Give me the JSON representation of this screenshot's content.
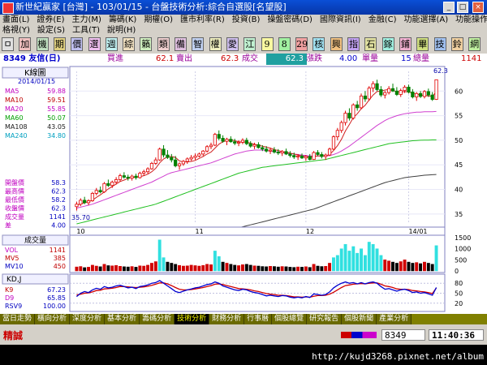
{
  "window": {
    "app_title": "新世紀贏家 [台灣] - 103/01/15 - 台盤技術分析:綜合自選股[名望股]",
    "minimize_label": "_",
    "maximize_label": "□",
    "close_label": "×"
  },
  "menu_row1": [
    "畫面(L)",
    "證券(E)",
    "主力(M)",
    "籌碼(K)",
    "期權(O)",
    "匯市利率(R)",
    "投資(B)",
    "操盤密碼(D)",
    "國際資訊(I)",
    "金融(C)",
    "功能選擇(A)",
    "功能操作(F)"
  ],
  "menu_row2": [
    "格視(Y)",
    "設定(S)",
    "工具(T)",
    "說明(H)"
  ],
  "toolbar": [
    "ㅁ",
    "加",
    "機",
    "期",
    "價",
    "選",
    "週",
    "綜",
    "籟",
    "類",
    "備",
    "智",
    "權",
    "愛",
    "江",
    "9",
    "8",
    "29",
    "核",
    "興",
    "指",
    "石",
    "鎵",
    "鋪",
    "畢",
    "技",
    "鈴",
    "網"
  ],
  "infobar": {
    "stock": "8349 友信(日)",
    "buy_label": "買進",
    "buy_value": "62.1",
    "sell_label": "賣出",
    "sell_value": "62.3",
    "deal_label": "成交",
    "deal_value": "62.3",
    "change_label": "漲跌",
    "change_value": "4.00",
    "unit_label": "單量",
    "unit_value": "15",
    "total_label": "總量",
    "total_value": "1141"
  },
  "legend": {
    "title": "K線圖",
    "date": "2014/01/15",
    "ma": [
      {
        "name": "MA5",
        "value": "59.88",
        "color": "#c000c0"
      },
      {
        "name": "MA10",
        "value": "59.51",
        "color": "#c00000"
      },
      {
        "name": "MA20",
        "value": "55.85",
        "color": "#c000c0"
      },
      {
        "name": "MA60",
        "value": "50.07",
        "color": "#00a000"
      },
      {
        "name": "MA108",
        "value": "43.05",
        "color": "#202020"
      },
      {
        "name": "MA240",
        "value": "34.80",
        "color": "#00a0c0"
      }
    ],
    "quote": [
      {
        "name": "開盤價",
        "value": "58.3"
      },
      {
        "name": "最高價",
        "value": "62.3"
      },
      {
        "name": "最低價",
        "value": "58.2"
      },
      {
        "name": "收盤價",
        "value": "62.3"
      },
      {
        "name": "成交量",
        "value": "1141"
      },
      {
        "name": "差",
        "value": "4.00"
      }
    ],
    "low_marker": "35.70",
    "high_marker": "62.3"
  },
  "volume_panel": {
    "title": "成交量",
    "rows": [
      {
        "name": "VOL",
        "value": "1141"
      },
      {
        "name": "MV5",
        "value": "385"
      },
      {
        "name": "MV10",
        "value": "450"
      }
    ]
  },
  "kd_panel": {
    "title": "KD,J",
    "rows": [
      {
        "name": "K9",
        "value": "67.23"
      },
      {
        "name": "D9",
        "value": "65.85"
      },
      {
        "name": "RSV9",
        "value": "100.00"
      }
    ]
  },
  "chart_data": {
    "type": "candlestick",
    "price_ticks": [
      "60",
      "55",
      "50",
      "45",
      "40",
      "35"
    ],
    "price_ylim": [
      33,
      64
    ],
    "month_labels": [
      {
        "label": "10",
        "x": 0
      },
      {
        "label": "11",
        "x": 30
      },
      {
        "label": "12",
        "x": 58
      },
      {
        "label": "14/01",
        "x": 84
      }
    ],
    "volume_ticks": [
      "1500",
      "1000",
      "500",
      "0"
    ],
    "volume_ylim": [
      0,
      1500
    ],
    "kd_ticks": [
      "80",
      "50",
      "20"
    ],
    "kd_ylim": [
      0,
      100
    ],
    "candles": [
      [
        36.5,
        37.5,
        35.7,
        37.0
      ],
      [
        37.0,
        38.2,
        36.6,
        37.8
      ],
      [
        37.8,
        38.5,
        37.0,
        37.3
      ],
      [
        37.3,
        38.0,
        36.8,
        37.7
      ],
      [
        37.7,
        39.5,
        37.5,
        39.2
      ],
      [
        39.2,
        40.3,
        38.8,
        39.8
      ],
      [
        39.8,
        40.6,
        39.2,
        39.5
      ],
      [
        39.5,
        41.5,
        39.3,
        41.2
      ],
      [
        41.2,
        42.0,
        40.5,
        40.8
      ],
      [
        40.8,
        41.8,
        40.3,
        41.5
      ],
      [
        41.5,
        42.5,
        41.0,
        42.0
      ],
      [
        42.0,
        43.2,
        41.6,
        42.8
      ],
      [
        42.8,
        43.5,
        42.2,
        42.5
      ],
      [
        42.5,
        43.0,
        41.8,
        42.3
      ],
      [
        42.3,
        43.0,
        41.8,
        42.7
      ],
      [
        42.7,
        43.2,
        42.0,
        42.4
      ],
      [
        42.4,
        43.6,
        42.2,
        43.3
      ],
      [
        43.3,
        44.0,
        42.8,
        43.6
      ],
      [
        43.6,
        44.5,
        43.2,
        44.2
      ],
      [
        44.2,
        45.6,
        44.0,
        45.3
      ],
      [
        45.3,
        46.5,
        45.0,
        46.0
      ],
      [
        46.0,
        48.5,
        45.8,
        48.2
      ],
      [
        48.2,
        49.0,
        46.5,
        47.0
      ],
      [
        47.0,
        48.0,
        46.2,
        46.5
      ],
      [
        46.5,
        47.2,
        45.5,
        46.0
      ],
      [
        46.0,
        46.8,
        44.5,
        44.8
      ],
      [
        44.8,
        45.5,
        44.0,
        45.2
      ],
      [
        45.2,
        46.0,
        44.8,
        45.7
      ],
      [
        45.7,
        46.5,
        45.2,
        46.2
      ],
      [
        46.2,
        47.0,
        45.8,
        46.5
      ],
      [
        46.5,
        47.3,
        46.0,
        46.8
      ],
      [
        46.8,
        47.5,
        46.5,
        47.2
      ],
      [
        47.2,
        48.0,
        46.8,
        47.8
      ],
      [
        47.8,
        49.0,
        47.5,
        48.7
      ],
      [
        48.7,
        49.5,
        48.2,
        49.0
      ],
      [
        49.0,
        51.5,
        48.8,
        51.2
      ],
      [
        51.2,
        52.0,
        50.0,
        50.4
      ],
      [
        50.4,
        51.0,
        49.5,
        49.8
      ],
      [
        49.8,
        50.5,
        49.0,
        50.2
      ],
      [
        50.2,
        50.8,
        49.5,
        49.7
      ],
      [
        49.7,
        50.3,
        49.0,
        49.4
      ],
      [
        49.4,
        50.0,
        48.8,
        49.6
      ],
      [
        49.6,
        50.4,
        49.2,
        50.0
      ],
      [
        50.0,
        50.5,
        49.0,
        49.3
      ],
      [
        49.3,
        49.8,
        48.5,
        48.8
      ],
      [
        48.8,
        49.5,
        48.2,
        49.1
      ],
      [
        49.1,
        49.6,
        48.3,
        48.5
      ],
      [
        48.5,
        49.0,
        47.8,
        48.2
      ],
      [
        48.2,
        48.8,
        47.5,
        47.8
      ],
      [
        47.8,
        48.5,
        47.2,
        48.0
      ],
      [
        48.0,
        48.6,
        47.3,
        47.6
      ],
      [
        47.6,
        48.2,
        47.0,
        47.4
      ],
      [
        47.4,
        48.0,
        46.8,
        47.7
      ],
      [
        47.7,
        48.3,
        47.0,
        47.2
      ],
      [
        47.2,
        47.8,
        46.5,
        46.9
      ],
      [
        46.9,
        47.5,
        46.2,
        46.6
      ],
      [
        46.6,
        47.2,
        46.0,
        46.8
      ],
      [
        46.8,
        47.3,
        46.2,
        46.4
      ],
      [
        46.4,
        47.0,
        45.8,
        46.7
      ],
      [
        46.7,
        47.2,
        45.9,
        46.1
      ],
      [
        46.1,
        47.8,
        46.0,
        47.5
      ],
      [
        47.5,
        48.0,
        46.8,
        47.1
      ],
      [
        47.1,
        47.6,
        46.3,
        46.7
      ],
      [
        46.7,
        47.3,
        46.0,
        47.0
      ],
      [
        47.0,
        48.5,
        46.8,
        48.2
      ],
      [
        48.2,
        51.0,
        48.0,
        50.7
      ],
      [
        50.7,
        52.5,
        50.0,
        52.0
      ],
      [
        52.0,
        54.0,
        51.5,
        53.6
      ],
      [
        53.6,
        56.0,
        53.0,
        55.5
      ],
      [
        55.5,
        56.5,
        54.0,
        54.5
      ],
      [
        54.5,
        57.5,
        54.2,
        57.2
      ],
      [
        57.2,
        58.0,
        56.0,
        56.6
      ],
      [
        56.6,
        59.5,
        56.3,
        59.0
      ],
      [
        59.0,
        60.0,
        57.8,
        58.4
      ],
      [
        58.4,
        61.0,
        58.0,
        60.6
      ],
      [
        60.6,
        62.0,
        59.8,
        61.5
      ],
      [
        61.5,
        62.3,
        60.0,
        60.3
      ],
      [
        60.3,
        61.0,
        58.8,
        59.2
      ],
      [
        59.2,
        60.0,
        58.5,
        59.7
      ],
      [
        59.7,
        61.0,
        59.3,
        60.5
      ],
      [
        60.5,
        61.5,
        59.8,
        60.0
      ],
      [
        60.0,
        60.8,
        59.0,
        59.3
      ],
      [
        59.3,
        60.5,
        58.8,
        60.1
      ],
      [
        60.1,
        61.2,
        59.6,
        60.8
      ],
      [
        60.8,
        61.3,
        59.5,
        59.8
      ],
      [
        59.8,
        60.4,
        58.5,
        58.8
      ],
      [
        58.8,
        59.8,
        58.0,
        59.5
      ],
      [
        59.5,
        60.0,
        58.6,
        58.9
      ],
      [
        58.9,
        60.2,
        58.5,
        59.9
      ],
      [
        59.9,
        60.5,
        58.8,
        59.2
      ],
      [
        59.2,
        59.8,
        58.0,
        58.3
      ],
      [
        58.3,
        62.3,
        58.2,
        62.3
      ]
    ],
    "volume": [
      180,
      200,
      150,
      170,
      260,
      220,
      190,
      300,
      240,
      230,
      250,
      210,
      190,
      180,
      200,
      170,
      230,
      220,
      260,
      350,
      420,
      1400,
      600,
      400,
      350,
      300,
      250,
      220,
      230,
      260,
      240,
      220,
      250,
      300,
      280,
      900,
      650,
      400,
      350,
      300,
      260,
      240,
      280,
      300,
      260,
      230,
      220,
      200,
      190,
      210,
      200,
      180,
      200,
      190,
      170,
      160,
      180,
      170,
      190,
      160,
      300,
      220,
      200,
      210,
      350,
      600,
      700,
      1000,
      1200,
      900,
      1100,
      800,
      1000,
      700,
      1300,
      1200,
      1000,
      700,
      500,
      450,
      400,
      350,
      420,
      500,
      400,
      350,
      380,
      330,
      400,
      350,
      300,
      1141
    ],
    "kd": {
      "k": [
        40,
        50,
        55,
        52,
        60,
        65,
        62,
        70,
        66,
        68,
        72,
        74,
        70,
        66,
        68,
        64,
        70,
        72,
        75,
        80,
        82,
        88,
        80,
        72,
        64,
        55,
        52,
        56,
        60,
        63,
        66,
        68,
        72,
        76,
        78,
        84,
        80,
        72,
        68,
        64,
        60,
        58,
        62,
        60,
        55,
        52,
        50,
        46,
        42,
        44,
        42,
        40,
        43,
        42,
        38,
        36,
        38,
        36,
        40,
        37,
        48,
        46,
        44,
        46,
        54,
        66,
        74,
        80,
        84,
        80,
        82,
        78,
        82,
        78,
        82,
        84,
        80,
        70,
        62,
        64,
        60,
        56,
        60,
        62,
        58,
        52,
        54,
        50,
        52,
        48,
        44,
        67.23
      ],
      "d": [
        45,
        47,
        50,
        51,
        54,
        58,
        59,
        63,
        64,
        65,
        67,
        70,
        70,
        69,
        68,
        67,
        68,
        69,
        71,
        74,
        77,
        81,
        81,
        78,
        73,
        67,
        62,
        60,
        60,
        61,
        63,
        65,
        67,
        70,
        73,
        77,
        78,
        76,
        73,
        70,
        67,
        64,
        63,
        62,
        60,
        57,
        55,
        52,
        49,
        47,
        46,
        44,
        44,
        43,
        41,
        39,
        39,
        38,
        39,
        38,
        41,
        43,
        43,
        44,
        47,
        53,
        60,
        67,
        73,
        75,
        77,
        78,
        79,
        78,
        80,
        81,
        81,
        77,
        72,
        70,
        67,
        63,
        62,
        62,
        61,
        58,
        57,
        55,
        54,
        52,
        49,
        65.85
      ]
    },
    "ma5_line": [
      36.8,
      37.0,
      37.3,
      37.5,
      37.8,
      38.4,
      38.9,
      39.5,
      40.1,
      40.6,
      41.1,
      41.6,
      41.9,
      42.2,
      42.4,
      42.5,
      42.6,
      42.8,
      43.1,
      43.6,
      44.3,
      45.4,
      46.2,
      46.6,
      46.7,
      46.5,
      45.8,
      45.6,
      45.6,
      45.7,
      45.9,
      46.3,
      46.7,
      47.2,
      47.6,
      48.4,
      49.2,
      49.7,
      49.9,
      50.1,
      49.9,
      49.7,
      49.6,
      49.6,
      49.4,
      49.2,
      49.0,
      48.8,
      48.6,
      48.4,
      48.1,
      47.9,
      47.7,
      47.6,
      47.4,
      47.2,
      47.0,
      46.8,
      46.7,
      46.5,
      46.7,
      46.8,
      46.8,
      46.8,
      47.1,
      47.9,
      48.9,
      50.2,
      51.9,
      53.2,
      54.6,
      55.4,
      56.4,
      57.1,
      58.2,
      59.2,
      59.9,
      60.0,
      60.2,
      60.3,
      60.1,
      59.9,
      59.8,
      59.9,
      59.8,
      59.6,
      59.4,
      59.2,
      59.1,
      59.0,
      58.9,
      59.88
    ],
    "ma20_line": [
      36.2,
      36.4,
      36.6,
      36.8,
      37.0,
      37.3,
      37.6,
      37.9,
      38.2,
      38.5,
      38.8,
      39.1,
      39.4,
      39.7,
      40.0,
      40.3,
      40.6,
      40.9,
      41.2,
      41.5,
      41.9,
      42.3,
      42.7,
      43.1,
      43.4,
      43.6,
      43.8,
      44.0,
      44.2,
      44.4,
      44.6,
      44.8,
      45.0,
      45.2,
      45.4,
      45.7,
      46.0,
      46.3,
      46.6,
      46.9,
      47.2,
      47.4,
      47.6,
      47.8,
      47.9,
      48.0,
      48.0,
      48.0,
      47.9,
      47.8,
      47.7,
      47.6,
      47.5,
      47.4,
      47.3,
      47.2,
      47.1,
      47.0,
      46.9,
      46.8,
      46.8,
      46.8,
      46.8,
      46.8,
      46.9,
      47.1,
      47.4,
      47.8,
      48.3,
      48.8,
      49.4,
      50.0,
      50.6,
      51.2,
      51.8,
      52.4,
      53.0,
      53.5,
      54.0,
      54.4,
      54.7,
      55.0,
      55.2,
      55.4,
      55.5,
      55.6,
      55.7,
      55.7,
      55.8,
      55.8,
      55.8,
      55.85
    ],
    "ma60_line": [
      33.0,
      33.2,
      33.4,
      33.6,
      33.8,
      34.0,
      34.2,
      34.4,
      34.6,
      34.8,
      35.0,
      35.2,
      35.4,
      35.6,
      35.8,
      36.0,
      36.2,
      36.4,
      36.6,
      36.8,
      37.0,
      37.3,
      37.6,
      37.9,
      38.2,
      38.5,
      38.8,
      39.1,
      39.4,
      39.7,
      40.0,
      40.3,
      40.6,
      40.9,
      41.2,
      41.5,
      41.8,
      42.1,
      42.4,
      42.7,
      43.0,
      43.3,
      43.5,
      43.7,
      43.9,
      44.1,
      44.3,
      44.5,
      44.6,
      44.7,
      44.8,
      44.9,
      45.0,
      45.1,
      45.2,
      45.3,
      45.4,
      45.5,
      45.6,
      45.7,
      45.8,
      45.9,
      46.0,
      46.1,
      46.3,
      46.5,
      46.7,
      46.9,
      47.1,
      47.3,
      47.5,
      47.7,
      47.9,
      48.1,
      48.3,
      48.5,
      48.7,
      48.9,
      49.1,
      49.3,
      49.4,
      49.5,
      49.6,
      49.7,
      49.8,
      49.9,
      49.95,
      50.0,
      50.02,
      50.04,
      50.06,
      50.07
    ],
    "ma108_line": [
      28,
      28.1,
      28.2,
      28.3,
      28.4,
      28.5,
      28.6,
      28.7,
      28.8,
      28.9,
      29.0,
      29.1,
      29.2,
      29.3,
      29.4,
      29.5,
      29.6,
      29.7,
      29.8,
      29.9,
      30.0,
      30.1,
      30.2,
      30.3,
      30.4,
      30.5,
      30.6,
      30.7,
      30.8,
      30.9,
      31.0,
      31.1,
      31.2,
      31.3,
      31.4,
      31.5,
      31.6,
      31.7,
      31.8,
      31.9,
      32.0,
      32.2,
      32.4,
      32.6,
      32.8,
      33.0,
      33.2,
      33.4,
      33.6,
      33.8,
      34.0,
      34.2,
      34.4,
      34.6,
      34.8,
      35.0,
      35.2,
      35.4,
      35.6,
      35.8,
      36.0,
      36.3,
      36.6,
      36.9,
      37.2,
      37.5,
      37.8,
      38.1,
      38.4,
      38.7,
      39.0,
      39.3,
      39.6,
      39.9,
      40.2,
      40.5,
      40.8,
      41.1,
      41.4,
      41.6,
      41.8,
      42.0,
      42.2,
      42.4,
      42.5,
      42.6,
      42.7,
      42.8,
      42.9,
      42.95,
      43.0,
      43.05
    ]
  },
  "tabs": [
    "當日走勢",
    "橫向分析",
    "深度分析",
    "基本分析",
    "籌碼分析",
    "技術分析",
    "財務分析",
    "行事曆",
    "個股總覽",
    "研究報告",
    "個股新聞",
    "產業分析"
  ],
  "active_tab": 5,
  "status": {
    "mode": "精誠",
    "code": "8349",
    "time": "11:40:36"
  },
  "footer": {
    "url": "http://kujd3268.pixnet.net/album"
  }
}
